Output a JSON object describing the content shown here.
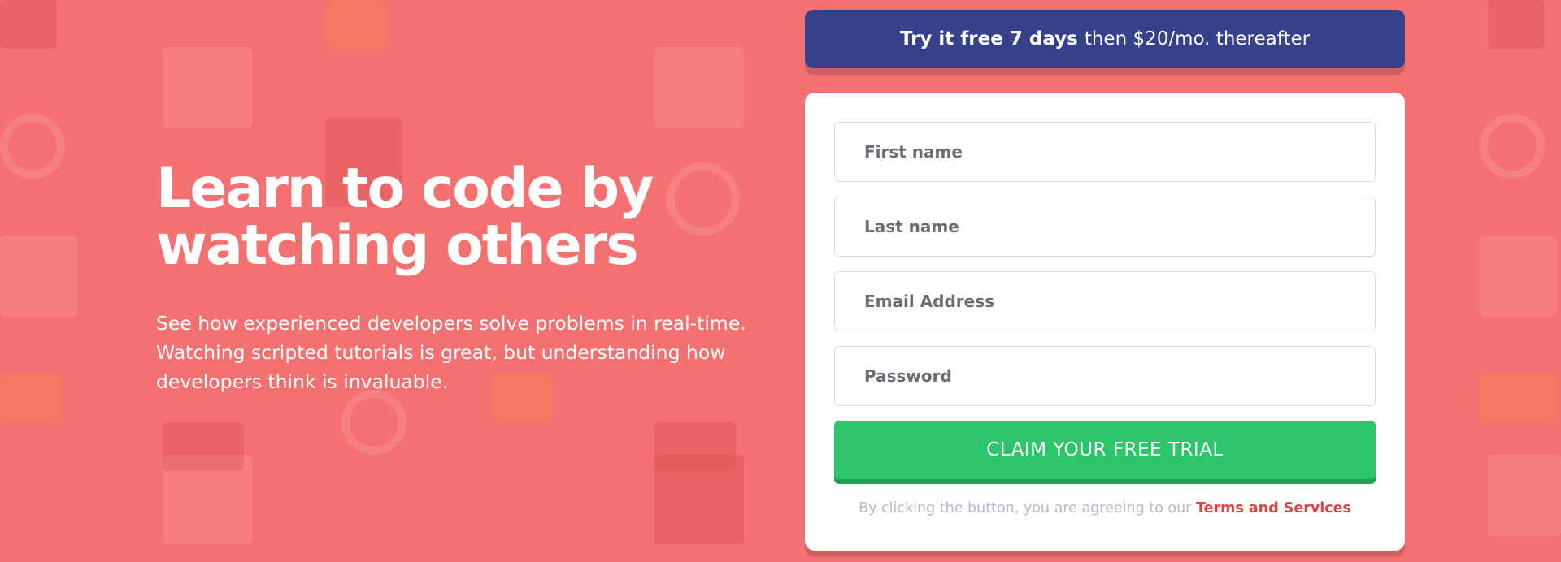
{
  "hero": {
    "headline_line1": "Learn to code by",
    "headline_line2": "watching others",
    "description": "See how experienced developers solve problems in real-time. Watching scripted tutorials is great, but understanding how developers think is invaluable."
  },
  "promo": {
    "bold_text": "Try it free 7 days",
    "rest_text": "then $20/mo. thereafter"
  },
  "form": {
    "first_name_placeholder": "First name",
    "last_name_placeholder": "Last name",
    "email_placeholder": "Email Address",
    "password_placeholder": "Password",
    "submit_label": "CLAIM YOUR FREE TRIAL",
    "terms_prefix": "By clicking the button, you are agreeing to our",
    "terms_link": "Terms and Services"
  },
  "colors": {
    "background": "#f57071",
    "promo": "#37408b",
    "button": "#2dc66b",
    "link": "#e8413f"
  }
}
